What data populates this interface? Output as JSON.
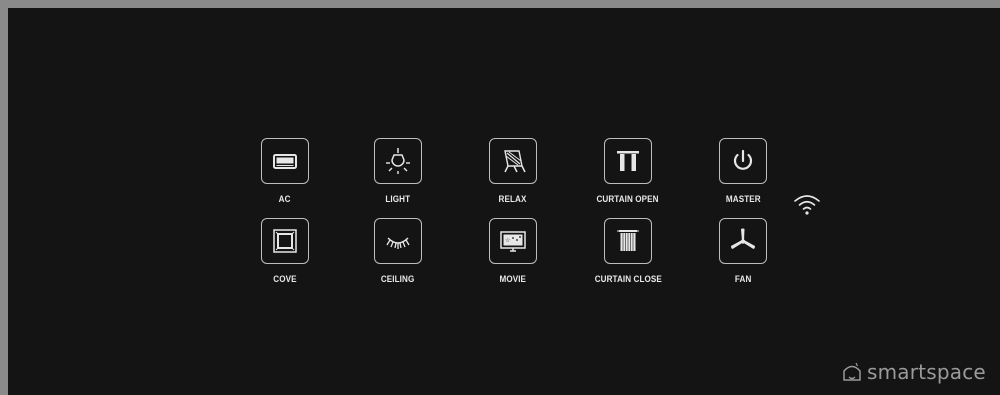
{
  "buttons_row1": [
    {
      "label": "AC",
      "icon": "ac-unit-icon"
    },
    {
      "label": "LIGHT",
      "icon": "light-bulb-icon"
    },
    {
      "label": "RELAX",
      "icon": "deck-chair-icon"
    },
    {
      "label": "CURTAIN OPEN",
      "icon": "curtain-open-icon"
    },
    {
      "label": "MASTER",
      "icon": "power-icon"
    }
  ],
  "buttons_row2": [
    {
      "label": "COVE",
      "icon": "cove-light-icon"
    },
    {
      "label": "CEILING",
      "icon": "ceiling-light-icon"
    },
    {
      "label": "MOVIE",
      "icon": "tv-icon"
    },
    {
      "label": "CURTAIN CLOSE",
      "icon": "curtain-close-icon"
    },
    {
      "label": "FAN",
      "icon": "fan-icon"
    }
  ],
  "status": {
    "icon": "wifi-icon"
  },
  "brand": {
    "name": "smartspace",
    "icon": "smartspace-logo-icon"
  },
  "colors": {
    "panel_background": "#141414",
    "frame": "#8a8a8a",
    "icon_stroke": "#e6e6e6",
    "label_text": "#e8e8e8",
    "brand_text": "#9a9a9a"
  }
}
